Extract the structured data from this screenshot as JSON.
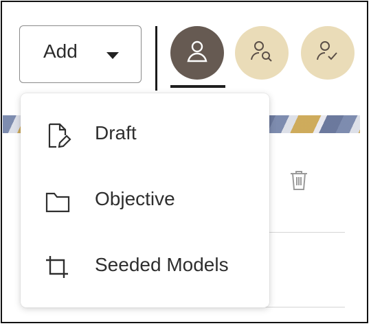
{
  "toolbar": {
    "add_label": "Add"
  },
  "avatars": [
    {
      "icon": "person-icon",
      "active": true
    },
    {
      "icon": "person-search-icon",
      "active": false
    },
    {
      "icon": "person-check-icon",
      "active": false
    }
  ],
  "menu": {
    "items": [
      {
        "label": "Draft",
        "icon": "draft-document-icon"
      },
      {
        "label": "Objective",
        "icon": "folder-icon"
      },
      {
        "label": "Seeded Models",
        "icon": "crop-icon"
      }
    ]
  },
  "colors": {
    "active_avatar": "#665a52",
    "inactive_avatar": "#eadcb8",
    "text": "#2b2b2b"
  }
}
